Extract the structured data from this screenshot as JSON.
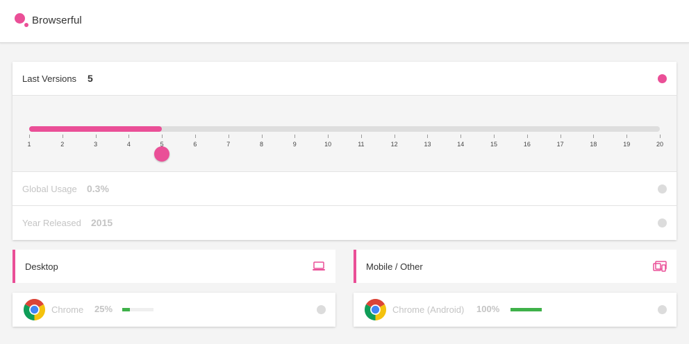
{
  "header": {
    "title": "Browserful"
  },
  "colors": {
    "accent": "#ea4f97",
    "usage_bar": "#3fb14a",
    "inactive_dot": "#dcdcdc"
  },
  "filters": {
    "last_versions": {
      "label": "Last Versions",
      "value": "5"
    },
    "slider": {
      "min": 1,
      "max": 20,
      "value": 5,
      "ticks": [
        "1",
        "2",
        "3",
        "4",
        "5",
        "6",
        "7",
        "8",
        "9",
        "10",
        "11",
        "12",
        "13",
        "14",
        "15",
        "16",
        "17",
        "18",
        "19",
        "20"
      ]
    },
    "global_usage": {
      "label": "Global Usage",
      "value": "0.3%"
    },
    "year_released": {
      "label": "Year Released",
      "value": "2015"
    }
  },
  "desktop": {
    "title": "Desktop",
    "icon": "laptop-icon",
    "browsers": [
      {
        "name": "Chrome",
        "percent": "25%",
        "usage_fraction": 0.25,
        "icon": "chrome-icon"
      }
    ]
  },
  "mobile": {
    "title": "Mobile / Other",
    "icon": "devices-icon",
    "browsers": [
      {
        "name": "Chrome (Android)",
        "percent": "100%",
        "usage_fraction": 1.0,
        "icon": "chrome-icon"
      }
    ]
  }
}
